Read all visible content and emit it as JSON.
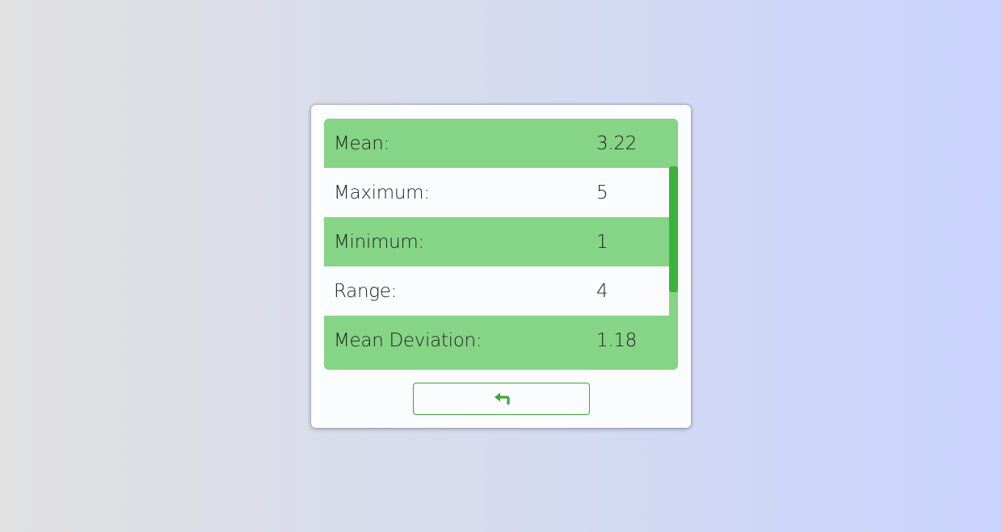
{
  "stats": {
    "rows": [
      {
        "label": "Mean:",
        "value": "3.22"
      },
      {
        "label": "Maximum:",
        "value": "5"
      },
      {
        "label": "Minimum:",
        "value": "1"
      },
      {
        "label": "Range:",
        "value": "4"
      },
      {
        "label": "Mean Deviation:",
        "value": "1.18"
      }
    ]
  },
  "back_button": {
    "icon": "return-arrow-icon"
  },
  "colors": {
    "row_green": "#86d486",
    "row_white": "#fbfcfe",
    "accent": "#3aa83a",
    "scroll_thumb": "#3bb33b"
  }
}
